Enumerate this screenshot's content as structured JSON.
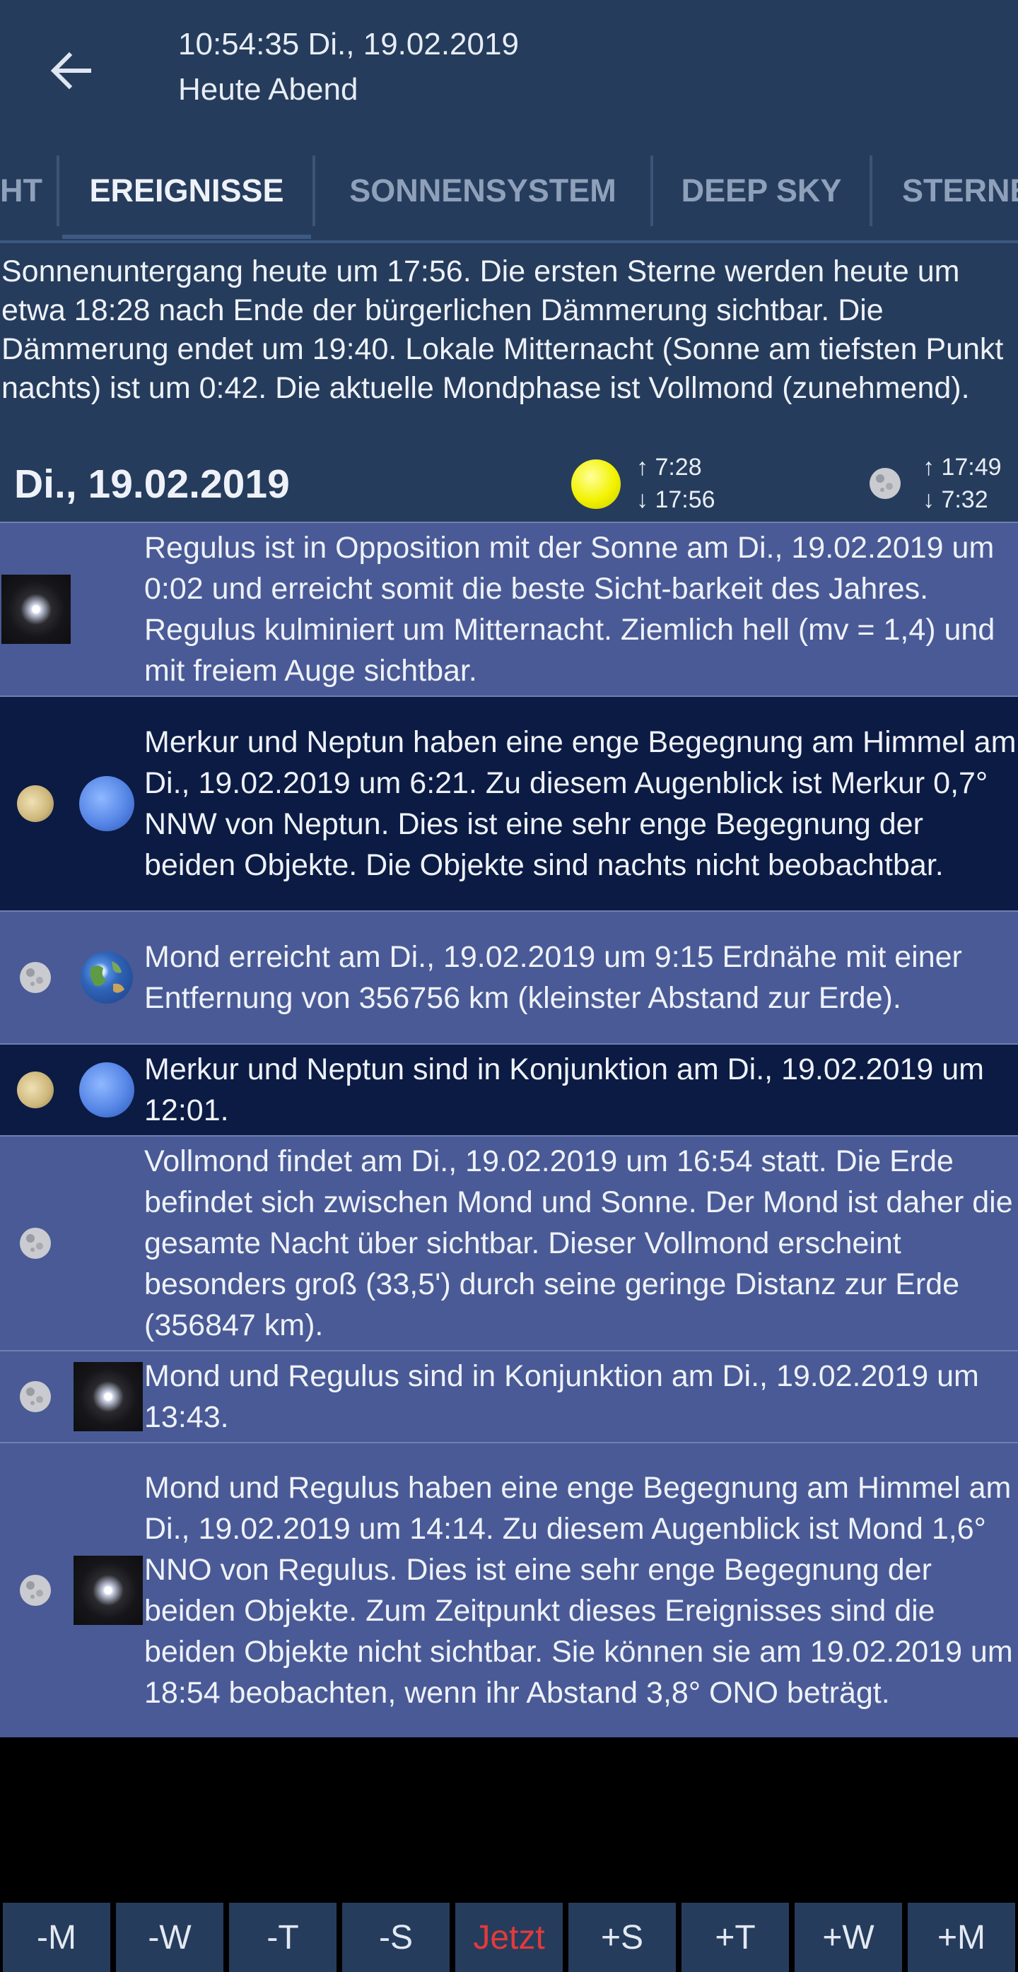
{
  "header": {
    "time": "10:54:35 Di., 19.02.2019",
    "subtitle": "Heute Abend"
  },
  "tabs": [
    {
      "label": "HT",
      "active": false
    },
    {
      "label": "EREIGNISSE",
      "active": true
    },
    {
      "label": "SONNENSYSTEM",
      "active": false
    },
    {
      "label": "DEEP SKY",
      "active": false
    },
    {
      "label": "STERNE",
      "active": false
    }
  ],
  "summary": "Sonnenuntergang heute um 17:56. Die ersten Sterne werden heute um etwa 18:28 nach Ende der bürgerlichen Dämmerung sichtbar. Die Dämmerung endet um 19:40. Lokale Mitternacht (Sonne am tiefsten Punkt nachts) ist um 0:42. Die aktuelle Mondphase ist Vollmond (zunehmend).",
  "day": {
    "date": "Di., 19.02.2019",
    "sun_rise": "↑ 7:28",
    "sun_set": "↓ 17:56",
    "moon_rise": "↑ 17:49",
    "moon_set": "↓ 7:32"
  },
  "events": [
    {
      "text": "Regulus ist in Opposition mit der Sonne am Di., 19.02.2019 um 0:02 und erreicht somit die beste Sicht-barkeit des Jahres. Regulus kulminiert um Mitternacht. Ziemlich hell (mv = 1,4) und mit freiem Auge sichtbar.",
      "icons": [
        "star-icon"
      ],
      "shade": "light"
    },
    {
      "text": "Merkur und Neptun haben eine enge Begegnung am Himmel am Di., 19.02.2019 um 6:21. Zu diesem Augenblick ist Merkur 0,7° NNW von Neptun. Dies ist eine sehr enge Begegnung der beiden Objekte. Die Objekte sind nachts nicht beobachtbar.",
      "icons": [
        "mercury-icon",
        "neptune-icon"
      ],
      "shade": "dark"
    },
    {
      "text": "Mond erreicht am Di., 19.02.2019 um 9:15 Erdnähe mit einer Entfernung von 356756 km (kleinster Abstand zur Erde).",
      "icons": [
        "moon-icon",
        "earth-icon"
      ],
      "shade": "light"
    },
    {
      "text": "Merkur und Neptun sind in Konjunktion am Di., 19.02.2019 um 12:01.",
      "icons": [
        "mercury-icon",
        "neptune-icon"
      ],
      "shade": "dark"
    },
    {
      "text": "Vollmond findet am Di., 19.02.2019 um 16:54 statt. Die Erde befindet sich zwischen Mond und Sonne. Der Mond ist daher die gesamte Nacht über sichtbar. Dieser Vollmond erscheint besonders groß (33,5') durch seine geringe Distanz zur Erde (356847 km).",
      "icons": [
        "moon-icon"
      ],
      "shade": "light"
    },
    {
      "text": "Mond und Regulus sind in Konjunktion am Di., 19.02.2019 um 13:43.",
      "icons": [
        "moon-icon",
        "star-icon"
      ],
      "shade": "light"
    },
    {
      "text": "Mond und Regulus haben eine enge Begegnung am Himmel am Di., 19.02.2019 um 14:14. Zu diesem Augenblick ist Mond 1,6° NNO von Regulus. Dies ist eine sehr enge Begegnung der beiden Objekte. Zum Zeitpunkt dieses Ereignisses sind die beiden Objekte nicht sichtbar. Sie können sie am 19.02.2019 um 18:54 beobachten, wenn ihr Abstand 3,8° ONO beträgt.",
      "icons": [
        "moon-icon",
        "star-icon"
      ],
      "shade": "light"
    }
  ],
  "bottom_bar": {
    "minus_month": "-M",
    "minus_week": "-W",
    "minus_day": "-T",
    "minus_hour": "-S",
    "now": "Jetzt",
    "plus_hour": "+S",
    "plus_day": "+T",
    "plus_week": "+W",
    "plus_month": "+M"
  },
  "colors": {
    "header_bg": "#263c5c",
    "row_light": "#4a5a96",
    "row_dark": "#0c1b44",
    "now_red": "#e23b3b"
  }
}
